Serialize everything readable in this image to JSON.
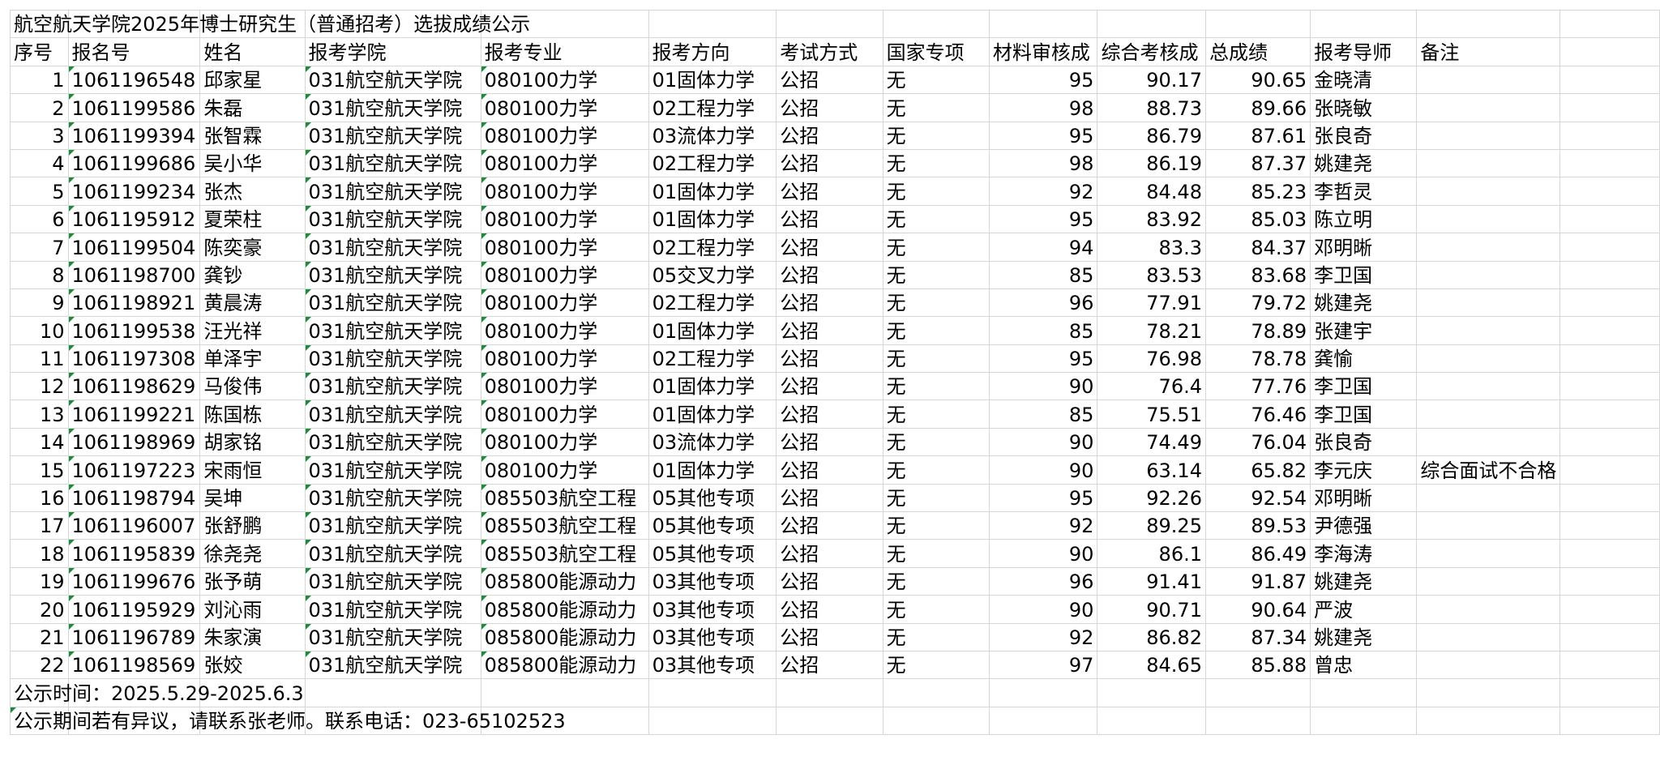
{
  "title": "航空航天学院2025年博士研究生（普通招考）选拔成绩公示",
  "headers": [
    "序号",
    "报名号",
    "姓名",
    "报考学院",
    "报考专业",
    "报考方向",
    "考试方式",
    "国家专项",
    "材料审核成",
    "综合考核成",
    "总成绩",
    "报考导师",
    "备注"
  ],
  "rows": [
    [
      "1",
      "1061196548",
      "邱家星",
      "031航空航天学院",
      "080100力学",
      "01固体力学",
      "公招",
      "无",
      "95",
      "90.17",
      "90.65",
      "金晓清",
      ""
    ],
    [
      "2",
      "1061199586",
      "朱磊",
      "031航空航天学院",
      "080100力学",
      "02工程力学",
      "公招",
      "无",
      "98",
      "88.73",
      "89.66",
      "张晓敏",
      ""
    ],
    [
      "3",
      "1061199394",
      "张智霖",
      "031航空航天学院",
      "080100力学",
      "03流体力学",
      "公招",
      "无",
      "95",
      "86.79",
      "87.61",
      "张良奇",
      ""
    ],
    [
      "4",
      "1061199686",
      "吴小华",
      "031航空航天学院",
      "080100力学",
      "02工程力学",
      "公招",
      "无",
      "98",
      "86.19",
      "87.37",
      "姚建尧",
      ""
    ],
    [
      "5",
      "1061199234",
      "张杰",
      "031航空航天学院",
      "080100力学",
      "01固体力学",
      "公招",
      "无",
      "92",
      "84.48",
      "85.23",
      "李哲灵",
      ""
    ],
    [
      "6",
      "1061195912",
      "夏荣柱",
      "031航空航天学院",
      "080100力学",
      "01固体力学",
      "公招",
      "无",
      "95",
      "83.92",
      "85.03",
      "陈立明",
      ""
    ],
    [
      "7",
      "1061199504",
      "陈奕豪",
      "031航空航天学院",
      "080100力学",
      "02工程力学",
      "公招",
      "无",
      "94",
      "83.3",
      "84.37",
      "邓明晰",
      ""
    ],
    [
      "8",
      "1061198700",
      "龚钞",
      "031航空航天学院",
      "080100力学",
      "05交叉力学",
      "公招",
      "无",
      "85",
      "83.53",
      "83.68",
      "李卫国",
      ""
    ],
    [
      "9",
      "1061198921",
      "黄晨涛",
      "031航空航天学院",
      "080100力学",
      "02工程力学",
      "公招",
      "无",
      "96",
      "77.91",
      "79.72",
      "姚建尧",
      ""
    ],
    [
      "10",
      "1061199538",
      "汪光祥",
      "031航空航天学院",
      "080100力学",
      "01固体力学",
      "公招",
      "无",
      "85",
      "78.21",
      "78.89",
      "张建宇",
      ""
    ],
    [
      "11",
      "1061197308",
      "单泽宇",
      "031航空航天学院",
      "080100力学",
      "02工程力学",
      "公招",
      "无",
      "95",
      "76.98",
      "78.78",
      "龚愉",
      ""
    ],
    [
      "12",
      "1061198629",
      "马俊伟",
      "031航空航天学院",
      "080100力学",
      "01固体力学",
      "公招",
      "无",
      "90",
      "76.4",
      "77.76",
      "李卫国",
      ""
    ],
    [
      "13",
      "1061199221",
      "陈国栋",
      "031航空航天学院",
      "080100力学",
      "01固体力学",
      "公招",
      "无",
      "85",
      "75.51",
      "76.46",
      "李卫国",
      ""
    ],
    [
      "14",
      "1061198969",
      "胡家铭",
      "031航空航天学院",
      "080100力学",
      "03流体力学",
      "公招",
      "无",
      "90",
      "74.49",
      "76.04",
      "张良奇",
      ""
    ],
    [
      "15",
      "1061197223",
      "宋雨恒",
      "031航空航天学院",
      "080100力学",
      "01固体力学",
      "公招",
      "无",
      "90",
      "63.14",
      "65.82",
      "李元庆",
      "综合面试不合格"
    ],
    [
      "16",
      "1061198794",
      "吴坤",
      "031航空航天学院",
      "085503航空工程",
      "05其他专项",
      "公招",
      "无",
      "95",
      "92.26",
      "92.54",
      "邓明晰",
      ""
    ],
    [
      "17",
      "1061196007",
      "张舒鹏",
      "031航空航天学院",
      "085503航空工程",
      "05其他专项",
      "公招",
      "无",
      "92",
      "89.25",
      "89.53",
      "尹德强",
      ""
    ],
    [
      "18",
      "1061195839",
      "徐尧尧",
      "031航空航天学院",
      "085503航空工程",
      "05其他专项",
      "公招",
      "无",
      "90",
      "86.1",
      "86.49",
      "李海涛",
      ""
    ],
    [
      "19",
      "1061199676",
      "张予萌",
      "031航空航天学院",
      "085800能源动力",
      "03其他专项",
      "公招",
      "无",
      "96",
      "91.41",
      "91.87",
      "姚建尧",
      ""
    ],
    [
      "20",
      "1061195929",
      "刘沁雨",
      "031航空航天学院",
      "085800能源动力",
      "03其他专项",
      "公招",
      "无",
      "90",
      "90.71",
      "90.64",
      "严波",
      ""
    ],
    [
      "21",
      "1061196789",
      "朱家演",
      "031航空航天学院",
      "085800能源动力",
      "03其他专项",
      "公招",
      "无",
      "92",
      "86.82",
      "87.34",
      "姚建尧",
      ""
    ],
    [
      "22",
      "1061198569",
      "张姣",
      "031航空航天学院",
      "085800能源动力",
      "03其他专项",
      "公招",
      "无",
      "97",
      "84.65",
      "85.88",
      "曾忠",
      ""
    ]
  ],
  "footer": {
    "time": "公示时间：2025.5.29-2025.6.3",
    "contact": "公示期间若有异议，请联系张老师。联系电话：023-65102523"
  },
  "colors": {
    "grid": "#d6d6d6",
    "comment_flag": "#1e8a3a"
  }
}
